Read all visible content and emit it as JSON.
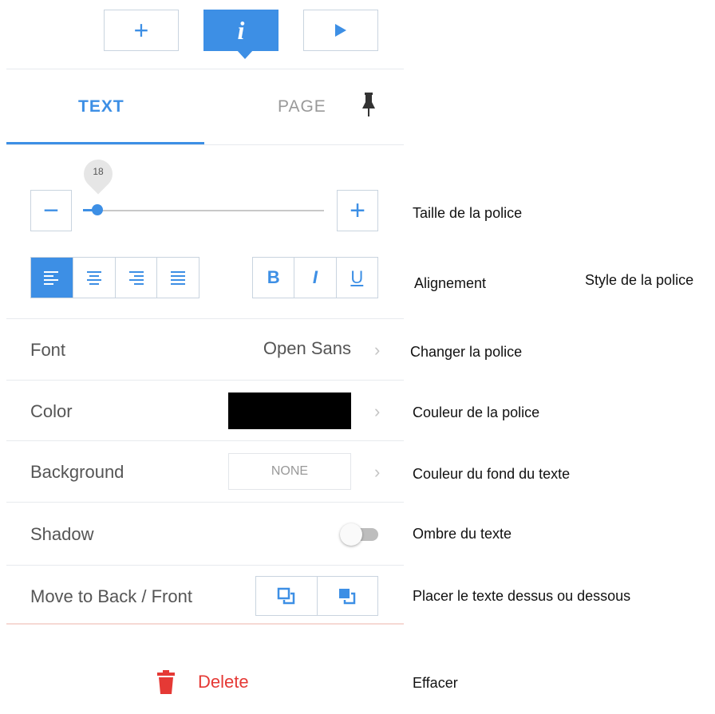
{
  "toolbar": {
    "add_label": "+",
    "info_label": "i"
  },
  "tabs": {
    "text": "TEXT",
    "page": "PAGE"
  },
  "font_size": {
    "value": "18",
    "minus_label": "−",
    "plus_label": "+",
    "slider_fraction": 0.05
  },
  "style_buttons": {
    "bold": "B",
    "italic": "I",
    "underline": "U"
  },
  "rows": {
    "font_label": "Font",
    "font_value": "Open Sans",
    "color_label": "Color",
    "color_value": "#000000",
    "background_label": "Background",
    "background_value": "NONE",
    "shadow_label": "Shadow",
    "move_label": "Move to Back / Front"
  },
  "delete_label": "Delete",
  "annotations": {
    "font_size": "Taille de la police",
    "alignment": "Alignement",
    "font_style": "Style de la police",
    "change_font": "Changer la police",
    "font_color": "Couleur de la police",
    "background_color": "Couleur du fond du texte",
    "shadow": "Ombre du texte",
    "layer": "Placer le texte dessus ou dessous",
    "delete": "Effacer"
  },
  "colors": {
    "accent": "#3d8fe5",
    "delete": "#e53935",
    "border": "#c9d4df"
  }
}
